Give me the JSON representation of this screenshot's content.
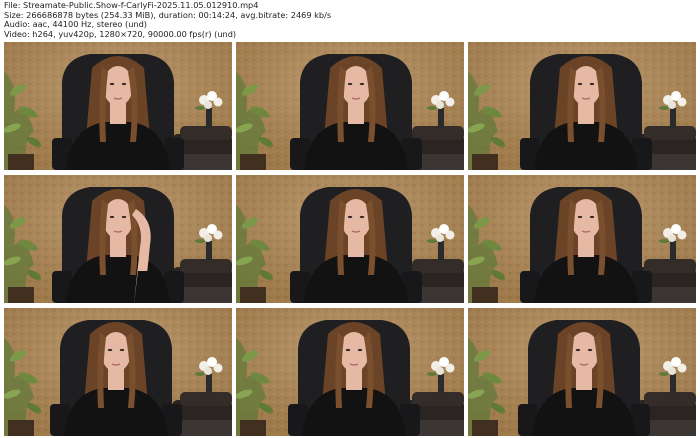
{
  "header": {
    "file_line": "File: Streamate-Public.Show-f-CarlyFi-2025.11.05.012910.mp4",
    "size_line": "Size: 266686878 bytes (254.33 MiB), duration: 00:14:24, avg.bitrate: 2469 kb/s",
    "audio_line": "Audio: aac, 44100 Hz, stereo (und)",
    "video_line": "Video: h264, yuv420p, 1280×720, 90000.00 fps(r) (und)"
  },
  "thumbnails": [
    {
      "pose": "neutral"
    },
    {
      "pose": "neutral"
    },
    {
      "pose": "neutral"
    },
    {
      "pose": "hand-on-head"
    },
    {
      "pose": "neutral"
    },
    {
      "pose": "neutral"
    },
    {
      "pose": "neutral"
    },
    {
      "pose": "neutral"
    },
    {
      "pose": "neutral"
    }
  ],
  "colors": {
    "wall": "#b38a55",
    "wall_dark": "#8a6638",
    "hair": "#6b4326",
    "skin": "#e6b9a4",
    "shirt": "#121212",
    "chair": "#1f1f22",
    "plant": "#5f7a3a",
    "flowers": "#f2efe8"
  }
}
